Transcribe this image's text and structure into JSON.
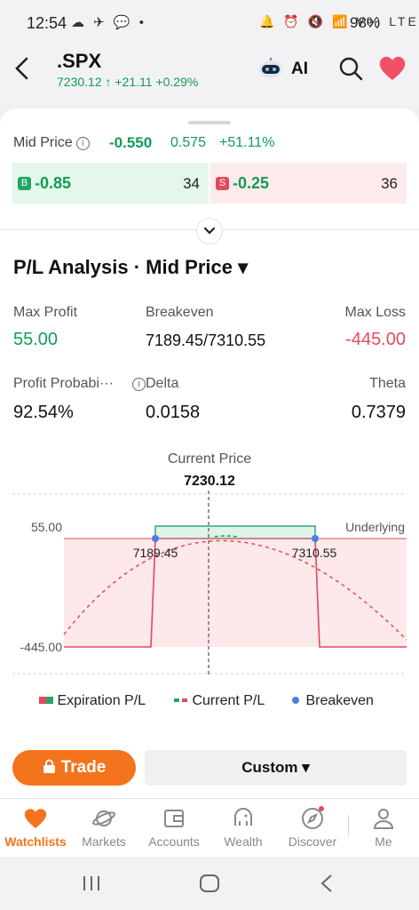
{
  "status": {
    "time": "12:54",
    "left_icons": "☁ ✈ 💬 •",
    "right_icons": "🔔 ⏰ 🔇 📶 Vo) LTE",
    "battery": "98%"
  },
  "header": {
    "symbol": ".SPX",
    "quote": "7230.12 ↑ +21.11 +0.29%",
    "ai_label": "AI"
  },
  "mid": {
    "label": "Mid Price",
    "value": "-0.550",
    "sec": "0.575",
    "pct": "+51.11%"
  },
  "bid": {
    "tag": "B",
    "price": "-0.85",
    "size": "34"
  },
  "ask": {
    "tag": "S",
    "price": "-0.25",
    "size": "36"
  },
  "analysis": {
    "title": "P/L Analysis · Mid Price ▾",
    "max_profit_label": "Max Profit",
    "max_profit": "55.00",
    "breakeven_label": "Breakeven",
    "breakeven": "7189.45/7310.55",
    "max_loss_label": "Max Loss",
    "max_loss": "-445.00",
    "prob_label": "Profit Probabi···",
    "prob": "92.54%",
    "delta_label": "Delta",
    "delta": "0.0158",
    "theta_label": "Theta",
    "theta": "0.7379"
  },
  "chart_data": {
    "type": "line",
    "current_price_label": "Current Price",
    "current_price": "7230.12",
    "y_ticks": [
      "55.00",
      "-445.00"
    ],
    "underlying_label": "Underlying",
    "breakeven_labels": [
      "7189.45",
      "7310.55"
    ],
    "breakevens": [
      7189.45,
      7310.55
    ],
    "max_profit": 55.0,
    "max_loss": -445.0,
    "legend": [
      "Expiration P/L",
      "Current P/L",
      "Breakeven"
    ],
    "colors": {
      "profit": "#22a566",
      "loss": "#e24a5c",
      "breakeven": "#4a7fe0"
    }
  },
  "actions": {
    "trade": "Trade",
    "custom": "Custom ▾"
  },
  "tabs": [
    {
      "label": "Watchlists",
      "active": true
    },
    {
      "label": "Markets"
    },
    {
      "label": "Accounts"
    },
    {
      "label": "Wealth"
    },
    {
      "label": "Discover"
    },
    {
      "label": "Me"
    }
  ]
}
